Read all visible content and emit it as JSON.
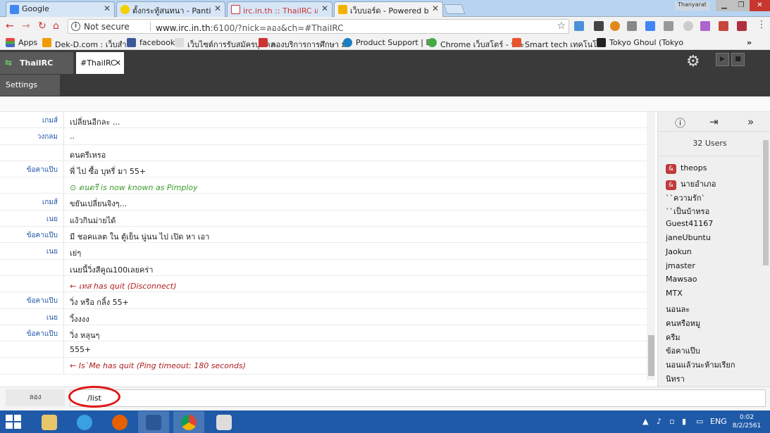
{
  "browser": {
    "tabs": [
      {
        "title": "Google"
      },
      {
        "title": "ตั้งกระทู้สนทนา - Pantip"
      },
      {
        "title": "irc.in.th :: ThaiIRC แชท คุย"
      },
      {
        "title": "เว็บบอร์ด - Powered by Di"
      }
    ],
    "user_badge": "Thanyarat",
    "security_label": "Not secure",
    "url_host": "www.irc.in.th",
    "url_rest": ":6100/?nick=ลอง&ch=#ThaiIRC",
    "bookmarks": [
      {
        "label": "Apps"
      },
      {
        "label": "Dek-D.com : เว็บสำหรั"
      },
      {
        "label": "facebook"
      },
      {
        "label": "เว็บไซต์การรับสมัครบุคคล"
      },
      {
        "label": "กองบริการการศึกษา ม"
      },
      {
        "label": "Product Support | De"
      },
      {
        "label": "Chrome เว็บสโตร์ - ประ"
      },
      {
        "label": "Smart tech เทคโนโลยี"
      },
      {
        "label": "Tokyo Ghoul (Tokyo"
      }
    ],
    "more_bookmarks": "»"
  },
  "irc": {
    "server_tab": "ThaiIRC",
    "channel_tab": "#ThaiIRC",
    "settings_tab": "Settings",
    "messages": [
      {
        "nick": "เกมส์",
        "text": "เปลี่ยนอีกละ ...",
        "kind": "normal"
      },
      {
        "nick": "วงกลม",
        "text": "..",
        "kind": "normal"
      },
      {
        "nick": "",
        "text": "ดนตรีเหรอ",
        "kind": "normal"
      },
      {
        "nick": "ข้อคาแป๊บ",
        "text": "พี่ ไป ซื้อ บุหรี่ มา 55+",
        "kind": "normal"
      },
      {
        "nick": "",
        "text": "⊙ ดนตรี is now known as Pimploy",
        "kind": "nickchg"
      },
      {
        "nick": "เกมส์",
        "text": "ขยันเปลี่ยนจิงๆ...",
        "kind": "normal"
      },
      {
        "nick": "เนย",
        "text": "แง้วกินม่ายได้",
        "kind": "normal"
      },
      {
        "nick": "ข้อคาแป๊บ",
        "text": "มี ชอคแลต ใน ตู้เย็น นู่นน ไป เปิด หา เอา",
        "kind": "normal"
      },
      {
        "nick": "เนย",
        "text": "เย่ๆ",
        "kind": "normal"
      },
      {
        "nick": "",
        "text": "เนยนี้วิ่งสีคูณ100เลยคร่า",
        "kind": "normal"
      },
      {
        "nick": "",
        "text": "← เทส has quit (Disconnect)",
        "kind": "quit"
      },
      {
        "nick": "ข้อคาแป๊บ",
        "text": "วิ่ง หรือ กลิ้ง 55+",
        "kind": "normal"
      },
      {
        "nick": "เนย",
        "text": "วิ้งงงง",
        "kind": "normal"
      },
      {
        "nick": "ข้อคาแป๊บ",
        "text": "วิ่ง หลุนๆ",
        "kind": "normal"
      },
      {
        "nick": "",
        "text": "555+",
        "kind": "normal"
      },
      {
        "nick": "",
        "text": "← Is`Me has quit (Ping timeout: 180 seconds)",
        "kind": "quit"
      }
    ],
    "user_count": "32 Users",
    "users": [
      {
        "name": "theops",
        "op": true
      },
      {
        "name": "นายอำเภอ",
        "op": true
      },
      {
        "name": "``ความรัก`",
        "op": false
      },
      {
        "name": "``เป็นบ้าหรอ",
        "op": false
      },
      {
        "name": "Guest41167",
        "op": false
      },
      {
        "name": "janeUbuntu",
        "op": false
      },
      {
        "name": "Jaokun",
        "op": false
      },
      {
        "name": "jmaster",
        "op": false
      },
      {
        "name": "Mawsao",
        "op": false
      },
      {
        "name": "MTX",
        "op": false
      },
      {
        "name": "นอนละ",
        "op": false
      },
      {
        "name": "คนหรือหมู",
        "op": false
      },
      {
        "name": "ครีม",
        "op": false
      },
      {
        "name": "ข้อคาแป๊บ",
        "op": false
      },
      {
        "name": "นอนแล้วนะห้ามเรียก",
        "op": false
      },
      {
        "name": "นิทรา",
        "op": false
      }
    ],
    "op_symbol": "&",
    "my_nick": "ลอง",
    "input_value": "/list"
  },
  "taskbar": {
    "lang": "ENG",
    "time": "0:02",
    "date": "8/2/2561"
  },
  "colors": {
    "accent_red": "#e01515",
    "op_badge": "#c0393b",
    "nick_blue": "#2255aa",
    "quit_red": "#b02020",
    "nickchange_green": "#3a9a2a"
  }
}
